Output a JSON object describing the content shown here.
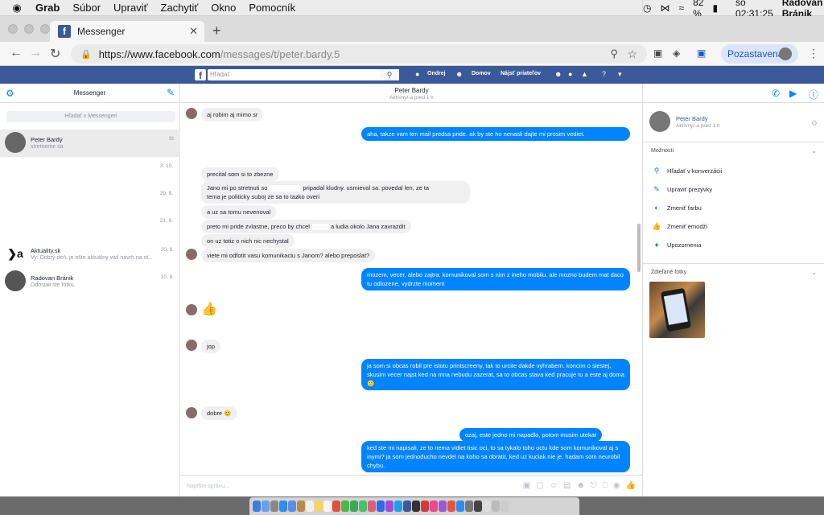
{
  "menubar": {
    "app": "Grab",
    "items": [
      "Súbor",
      "Upraviť",
      "Zachytiť",
      "Okno",
      "Pomocník"
    ],
    "battery": "82 %",
    "clock": "so 02:31:25",
    "user": "Radovan Bránik"
  },
  "browser": {
    "tab_title": "Messenger",
    "url_base": "https://www.facebook.com",
    "url_path": "/messages/t/peter.bardy.5",
    "profile_label": "Pozastavená"
  },
  "fb": {
    "search_placeholder": "Hľadať",
    "nav": [
      "Ondrej",
      "Domov",
      "Nájsť priateľov"
    ]
  },
  "sidebar": {
    "title": "Messenger",
    "search_placeholder": "Hľadať v Messengeri",
    "conversations": [
      {
        "name": "Peter Bardy",
        "snippet": "stretneme sa",
        "date": "St"
      },
      {
        "name": "Aktuality.sk",
        "snippet": "Vy: Dobrý deň, je ešte aktuálny váš návrh na st...",
        "date": "20. 9."
      },
      {
        "name": "Radovan Bránik",
        "snippet": "Odoslali ste fotku.",
        "date": "10. 9."
      }
    ],
    "date_separators": [
      "3. 10.",
      "29. 9.",
      "21. 9."
    ]
  },
  "chat": {
    "name": "Peter Bardy",
    "status": "Aktívny/-a pred 1 h",
    "messages": [
      "aj robim aj mimo sr",
      "aha, takze vam ten mail predsa pride. ak by ste ho nenasli dajte mi prosim vediet.",
      "precital som si to zbezne",
      "Jano mi po stretnuti so",
      "pripadal kludny. usmieval sa. povedal len, ze ta",
      "tema je politicky suboj ze sa to tazko overi",
      "a uz sa tomu nevenoval",
      "preto mi pride zvlastne, preco by chcel",
      "a ludia okolo Jana zavrazdit",
      "on uz totiz o nich nic nechystal",
      "viete mi odfotit vasu komunikaciu s Janom? alebo preposlat?",
      "mozem, vecer, alebo zajtra. komunikoval som s nim z ineho mobilu. ale mozno budem mat daco tu odlozene, vydrzte moment",
      "jop",
      "ja som si obcas robil pre istotu printscreeny, tak to urcite dakde vyhrabem. koncim o siestej, skusim vecer najst ked na mna nebudu zazerat, sa to obcas stava ked pracuje tu a este aj doma 🙂",
      "dobre 😊",
      "ozaj, este jedno mi napadlo, potom musim utekat",
      "ked ste mi napisali, ze to nema vidiet tisic oci, to sa tykalo toho uctu kde som komunikoval aj s inymi? ja som jednoducho nevdel na koho sa obratit, ked uz kuciak nie je. hadam som neurobil chybu."
    ],
    "compose_placeholder": "Napíšte správu..."
  },
  "details": {
    "name": "Peter Bardy",
    "status": "Aktívny/-a pred 1 h",
    "options_title": "Možnosti",
    "options": [
      "Hľadať v konverzácii",
      "Upraviť prezývky",
      "Zmeniť farbu",
      "Zmeniť emodží",
      "Upozornenia"
    ],
    "photos_title": "Zdieľané fotky"
  },
  "colors": {
    "fb_blue": "#3b5998",
    "messenger_blue": "#0084ff"
  }
}
